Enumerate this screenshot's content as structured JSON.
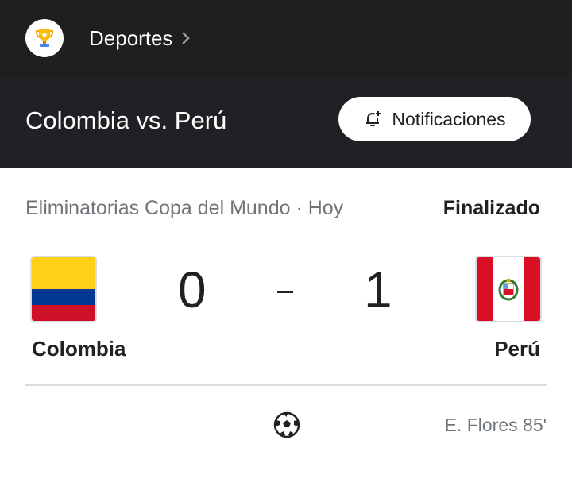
{
  "nav": {
    "section_label": "Deportes",
    "logo_icon": "trophy-icon",
    "chevron_icon": "chevron-right-icon"
  },
  "header": {
    "match_title": "Colombia vs. Perú",
    "notifications_label": "Notificaciones",
    "notifications_icon": "bell-add-icon"
  },
  "match": {
    "competition": "Eliminatorias Copa del Mundo · Hoy",
    "status": "Finalizado",
    "home": {
      "name": "Colombia",
      "score": "0",
      "flag_icon": "colombia-flag-icon"
    },
    "away": {
      "name": "Perú",
      "score": "1",
      "flag_icon": "peru-flag-icon"
    },
    "separator": "-",
    "goals": [
      {
        "scorer": "E. Flores 85'",
        "icon": "soccer-ball-icon",
        "team": "away"
      }
    ]
  },
  "colors": {
    "topbar_bg": "#1f1f1f",
    "header_bg": "#202124",
    "secondary_text": "#70757a",
    "primary_text": "#202124"
  }
}
